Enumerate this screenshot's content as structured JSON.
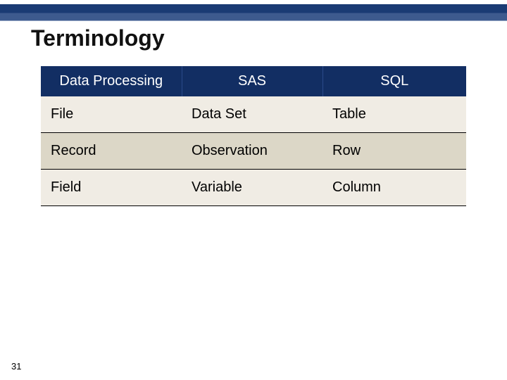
{
  "title": "Terminology",
  "table": {
    "headers": [
      "Data Processing",
      "SAS",
      "SQL"
    ],
    "rows": [
      [
        "File",
        "Data Set",
        "Table"
      ],
      [
        "Record",
        "Observation",
        "Row"
      ],
      [
        "Field",
        "Variable",
        "Column"
      ]
    ]
  },
  "page_number": "31"
}
